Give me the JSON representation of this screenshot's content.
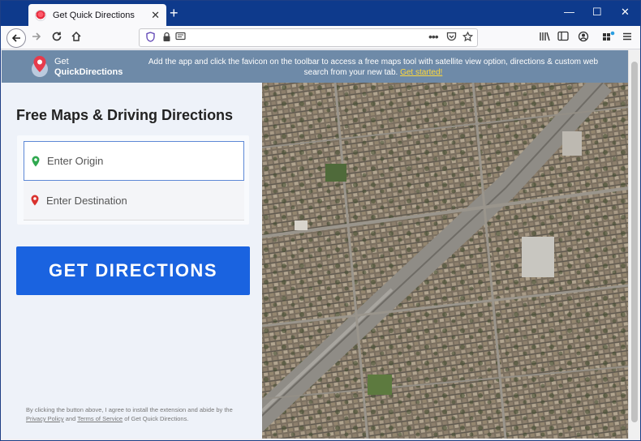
{
  "browser": {
    "tab_title": "Get Quick Directions",
    "tab_close": "✕",
    "new_tab": "+",
    "minimize": "—",
    "maximize": "☐",
    "close": "✕"
  },
  "banner": {
    "brand_line1": "Get",
    "brand_line2": "QuickDirections",
    "message": "Add the app and click the favicon on the toolbar to access a free maps tool with satellite view option, directions & custom web search from your new tab.",
    "link": "Get started!"
  },
  "main": {
    "headline": "Free Maps & Driving Directions",
    "origin_placeholder": "Enter Origin",
    "destination_placeholder": "Enter Destination",
    "cta_label": "GET DIRECTIONS",
    "disclaimer_pre": "By clicking the button above, I agree to install the extension and abide by the",
    "privacy_link": "Privacy Policy",
    "and": "and",
    "terms_link": "Terms of Service",
    "disclaimer_post": "of Get Quick Directions."
  },
  "colors": {
    "accent": "#1a63e0",
    "banner": "#6e8aa8",
    "link": "#ffd83a",
    "origin_pin": "#2fa84f",
    "destination_pin": "#d9322e"
  }
}
